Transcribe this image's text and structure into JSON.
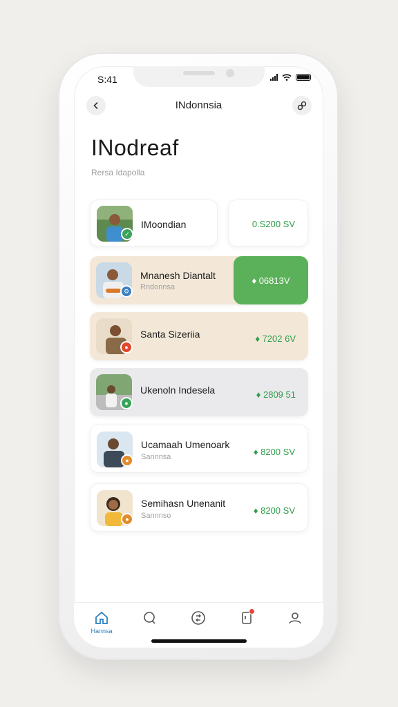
{
  "status_bar": {
    "time": "S:41"
  },
  "header": {
    "title": "INdonnsia"
  },
  "page": {
    "title": "INodreaf",
    "subtitle": "Rersa Idapolla"
  },
  "side_card": {
    "value": "0.S200 SV"
  },
  "list": [
    {
      "name": "IMoondian",
      "sub": "",
      "value": ""
    },
    {
      "name": "Mnanesh Diantalt",
      "sub": "Rndonnsa",
      "value": "♦ 06813V"
    },
    {
      "name": "Santa Sizeriia",
      "sub": "",
      "value": "♦ 7202 6V"
    },
    {
      "name": "Ukenoln Indesela",
      "sub": "",
      "value": "♦ 2809 51"
    },
    {
      "name": "Ucamaah Umenoark",
      "sub": "Sannnsa",
      "value": "♦ 8200 SV"
    },
    {
      "name": "Semihasn Unenanit",
      "sub": "Sannnso",
      "value": "♦ 8200 SV"
    }
  ],
  "tabbar": {
    "home_label": "Hannsa"
  },
  "colors": {
    "accent_green": "#5bb15a",
    "value_green": "#2f9c4a",
    "tab_blue": "#2b7fbf",
    "beige": "#f3e8d8"
  }
}
